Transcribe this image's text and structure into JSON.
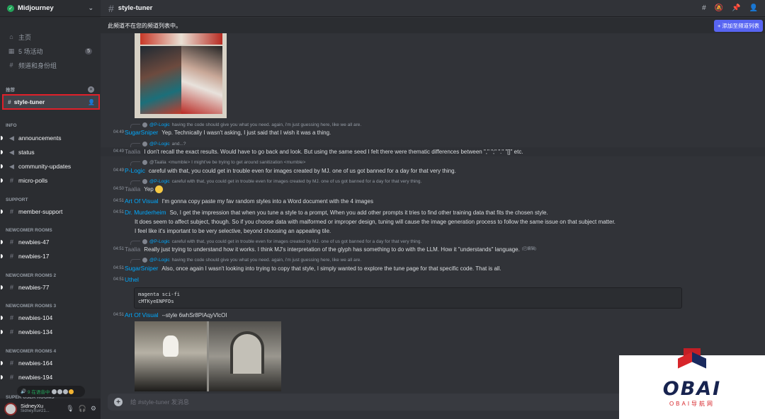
{
  "server": {
    "name": "Midjourney"
  },
  "sidebar": {
    "top_items": [
      {
        "icon": "home-icon",
        "label": "主页"
      },
      {
        "icon": "calendar-icon",
        "label": "5 场活动",
        "badge": "5"
      },
      {
        "icon": "channels-roles-icon",
        "label": "频道和身份组"
      }
    ],
    "recommended_label": "推荐",
    "selected_channel": "style-tuner",
    "categories": [
      {
        "name": "INFO",
        "channels": [
          "announcements",
          "status",
          "community-updates",
          "micro-polls"
        ]
      },
      {
        "name": "SUPPORT",
        "channels": [
          "member-support"
        ]
      },
      {
        "name": "NEWCOMER ROOMS",
        "channels": [
          "newbies-47",
          "newbies-17"
        ]
      },
      {
        "name": "NEWCOMER ROOMS 2",
        "channels": [
          "newbies-77"
        ]
      },
      {
        "name": "NEWCOMER ROOMS 3",
        "channels": [
          "newbies-104",
          "newbies-134"
        ]
      },
      {
        "name": "NEWCOMER ROOMS 4",
        "channels": [
          "newbies-164",
          "newbies-194"
        ]
      }
    ],
    "bottom_category": "SUPER USER ROOMS",
    "voice_pill": "9 在语音中",
    "user": {
      "name": "SidneyXu",
      "tag": "SidneyXu#21..."
    }
  },
  "topbar": {
    "channel": "style-tuner"
  },
  "notice": {
    "text": "此频道不在您的频道列表中。",
    "button": "+ 添加至频道列表"
  },
  "messages": {
    "r1": {
      "name": "@P-Logic",
      "text": "having the code should give you what you need. again, i'm just guessing here, like we all are."
    },
    "m1": {
      "time": "04:49",
      "author": "SugarSniper",
      "text": "Yep. Technically I wasn't asking, I just said that I wish it was a thing."
    },
    "r2": {
      "name": "@P-Logic",
      "text": "and...?"
    },
    "m2": {
      "time": "04:49",
      "author": "Taalia",
      "text": "I don't recall the exact results. Would have to go back and look. But using the same seed I felt there were thematic differences between \",\" \";\" \".\" \"[]\" etc."
    },
    "r3": {
      "name": "@Taalia",
      "text": "<mumble> I might've be trying to get around sanitization <mumble>"
    },
    "m3": {
      "time": "04:49",
      "author": "P-Logic",
      "text": "careful with that, you could get in trouble even for images created by MJ. one of us got banned for a day for that very thing."
    },
    "r4": {
      "name": "@P-Logic",
      "text": "careful with that, you could get in trouble even for images created by MJ. one of us got banned for a day for that very thing."
    },
    "m4": {
      "time": "04:50",
      "author": "Taalia",
      "text": "Yep"
    },
    "m5": {
      "time": "04:51",
      "author": "Art Of Visual",
      "text": "I'm gonna copy paste my fav random styles into a Word document with the 4 images"
    },
    "m6": {
      "time": "04:51",
      "author": "Dr. Murderheim",
      "text": "So, I get the impression that when you tune a style to a prompt, When you add other prompts it tries to find other training data that fits the chosen style.",
      "cont1": "It does seem to affect subject, though. So if you choose data with malformed or improper design, tuning will cause the image generation process to follow the same issue on that subject matter.",
      "cont2": "I feel like it's important to be very selective, beyond choosing an appealing tile."
    },
    "r5": {
      "name": "@P-Logic",
      "text": "careful with that, you could get in trouble even for images created by MJ. one of us got banned for a day for that very thing."
    },
    "m7": {
      "time": "04:51",
      "author": "Taalia",
      "text": "Really just trying to understand how it works. I think MJ's interpretation of the glyph has something to do with the LLM. How it \"understands\" language.",
      "edited": "(已编辑)"
    },
    "r6": {
      "name": "@P-Logic",
      "text": "having the code should give you what you need. again, i'm just guessing here, like we all are."
    },
    "m8": {
      "time": "04:51",
      "author": "SugarSniper",
      "text": "Also, once again I wasn't looking into trying to copy that style, I simply wanted to explore the tune page for that specific code. That is all."
    },
    "m9": {
      "time": "04:51",
      "author": "Uthel",
      "code1": "magenta sci-fi",
      "code2": "cMTKyeENPFDs"
    },
    "m10": {
      "time": "04:51",
      "author": "Art Of Visual",
      "text": "--style 6whSr8PIAqyVlcOI"
    }
  },
  "composer": {
    "placeholder": "给 #style-tuner 发消息"
  },
  "watermark": {
    "brand": "OBAI",
    "sub": "OBAI导航网"
  },
  "colors": {
    "accent": "#5865f2",
    "link": "#00a8fc",
    "highlight": "#e0202a",
    "online": "#23a55a"
  }
}
